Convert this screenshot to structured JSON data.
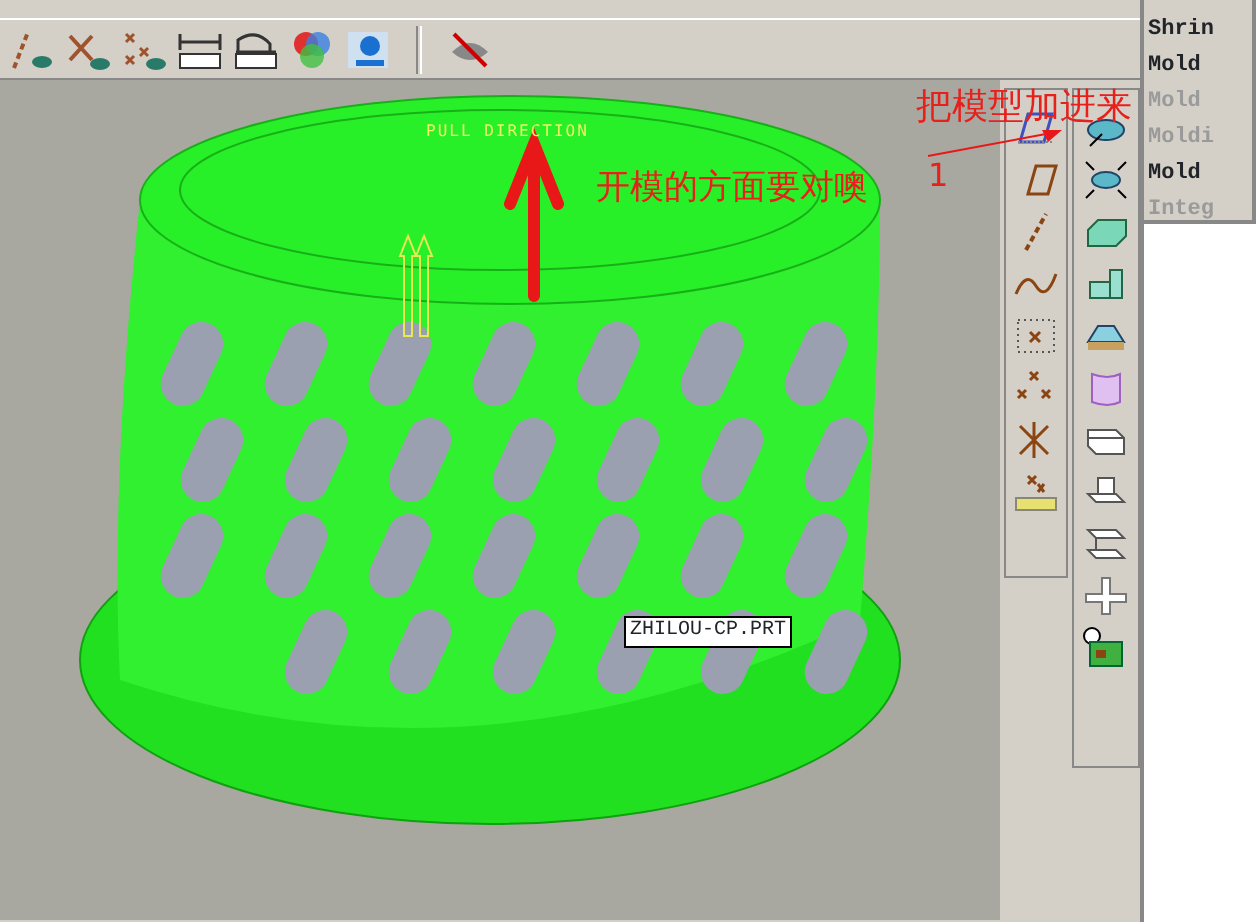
{
  "viewport": {
    "pull_direction_label": "PULL DIRECTION",
    "model_label": "ZHILOU-CP.PRT",
    "annotations": [
      {
        "kind": "note",
        "text": "开模的方面要对噢"
      },
      {
        "kind": "note-top",
        "text": "把模型加进来"
      },
      {
        "kind": "number",
        "text": "1"
      }
    ]
  },
  "menu": {
    "items": [
      {
        "label": "Shrin",
        "disabled": false
      },
      {
        "label": "Mold",
        "disabled": false
      },
      {
        "label": "Mold",
        "disabled": true
      },
      {
        "label": "Moldi",
        "disabled": true
      },
      {
        "label": "Mold",
        "disabled": false
      },
      {
        "label": "Integ",
        "disabled": true
      }
    ]
  }
}
